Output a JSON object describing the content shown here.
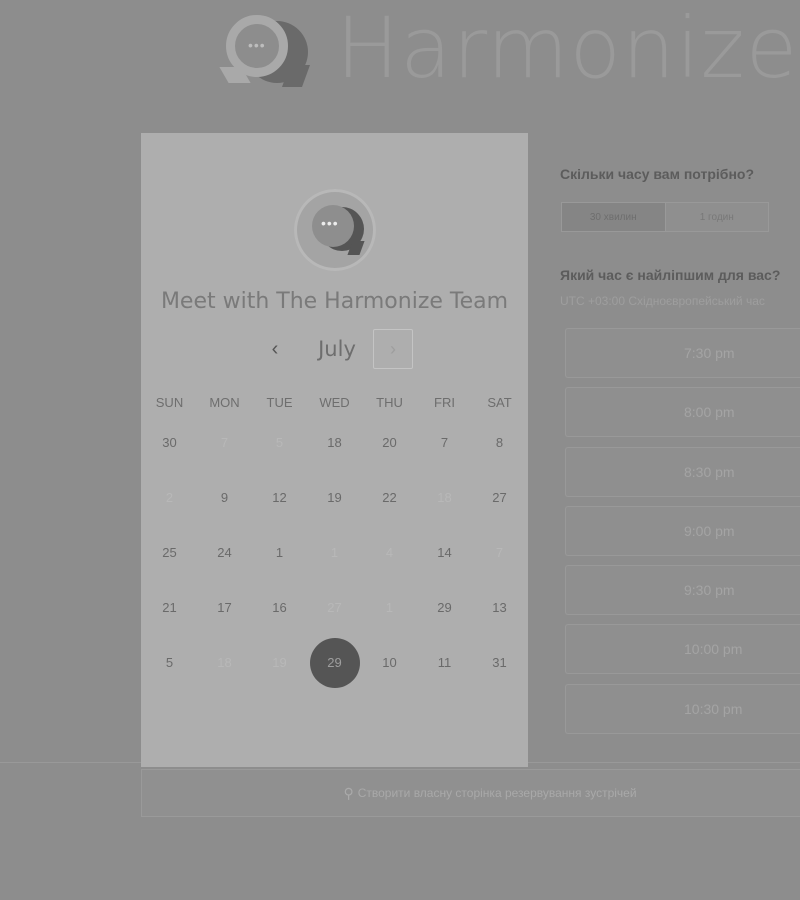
{
  "brand": {
    "name": "Harmonize",
    "logo_icon": "chat-bubble-logo-icon"
  },
  "card": {
    "avatar_icon": "chat-bubble-avatar-icon",
    "title": "Meet with The Harmonize Team",
    "month": "July",
    "prev_icon": "‹",
    "next_icon": "›",
    "weekdays": [
      "SUN",
      "MON",
      "TUE",
      "WED",
      "THU",
      "FRI",
      "SAT"
    ],
    "days": [
      [
        "30",
        "7",
        "5",
        "18",
        "20",
        "7",
        "8"
      ],
      [
        "2",
        "9",
        "12",
        "19",
        "22",
        "18",
        "27"
      ],
      [
        "25",
        "24",
        "1",
        "1",
        "4",
        "14",
        "7"
      ],
      [
        "21",
        "17",
        "16",
        "27",
        "1",
        "29",
        "13"
      ],
      [
        "5",
        "18",
        "19",
        "29",
        "10",
        "11",
        "31"
      ]
    ],
    "faded": [
      [
        0,
        1
      ],
      [
        0,
        2
      ],
      [
        1,
        0
      ],
      [
        1,
        5
      ],
      [
        2,
        3
      ],
      [
        2,
        4
      ],
      [
        2,
        6
      ],
      [
        3,
        3
      ],
      [
        3,
        4
      ],
      [
        4,
        1
      ],
      [
        4,
        2
      ]
    ],
    "selected": [
      4,
      3
    ]
  },
  "right": {
    "duration_question": "Скільки часу вам потрібно?",
    "durations": [
      "30 хвилин",
      "1 годин"
    ],
    "time_question": "Який час є найліпшим для вас?",
    "timezone": "UTC +03:00 Східноєвропейський час",
    "slots": [
      "7:30 pm",
      "8:00 pm",
      "8:30 pm",
      "9:00 pm",
      "9:30 pm",
      "10:00 pm",
      "10:30 pm"
    ]
  },
  "footer": {
    "link_label": "Створити власну сторінка резервування зустрічей",
    "icon": "sprocket-icon"
  },
  "colors": {
    "background": "#8d8d8d",
    "card": "#aeaeae",
    "selected_day": "#555555"
  }
}
